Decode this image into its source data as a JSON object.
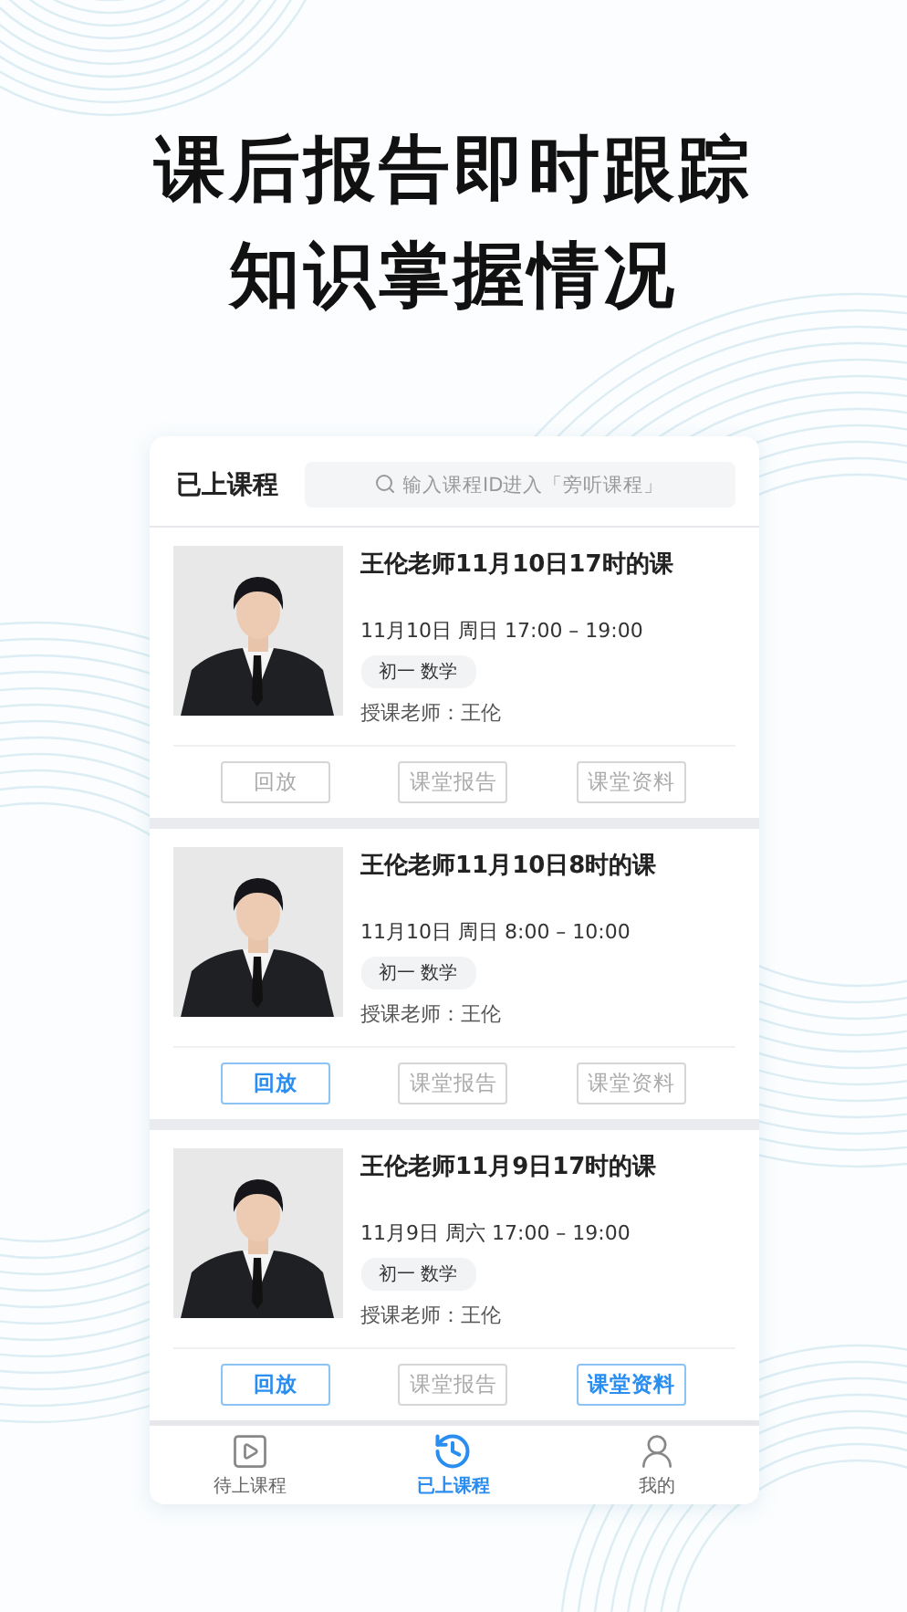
{
  "headline": [
    "课后报告即时跟踪",
    "知识掌握情况"
  ],
  "header": {
    "title": "已上课程",
    "search": {
      "placeholder": "输入课程ID进入「旁听课程」"
    }
  },
  "courses": [
    {
      "kind": "picture",
      "title": "王伦老师11月10日17时的课",
      "time": "11月10日 周日 17:00 – 19:00",
      "tag": "初一 数学",
      "teacher": "授课老师：王伦",
      "buttons": [
        {
          "label": "回放",
          "disabled": true
        },
        {
          "label": "课堂报告",
          "disabled": true
        },
        {
          "label": "课堂资料",
          "disabled": true
        }
      ]
    },
    {
      "kind": "picture",
      "title": "王伦老师11月10日8时的课",
      "time": "11月10日 周日 8:00 – 10:00",
      "tag": "初一 数学",
      "teacher": "授课老师：王伦",
      "buttons": [
        {
          "label": "回放",
          "disabled": false
        },
        {
          "label": "课堂报告",
          "disabled": true
        },
        {
          "label": "课堂资料",
          "disabled": true
        }
      ]
    },
    {
      "kind": "picture",
      "title": "王伦老师11月9日17时的课",
      "time": "11月9日 周六 17:00 – 19:00",
      "tag": "初一 数学",
      "teacher": "授课老师：王伦",
      "buttons": [
        {
          "label": "回放",
          "disabled": false
        },
        {
          "label": "课堂报告",
          "disabled": true
        },
        {
          "label": "课堂资料",
          "disabled": false
        }
      ]
    }
  ],
  "tabs": [
    {
      "label": "待上课程",
      "selected": false
    },
    {
      "label": "已上课程",
      "selected": true
    },
    {
      "label": "我的",
      "selected": false
    }
  ]
}
